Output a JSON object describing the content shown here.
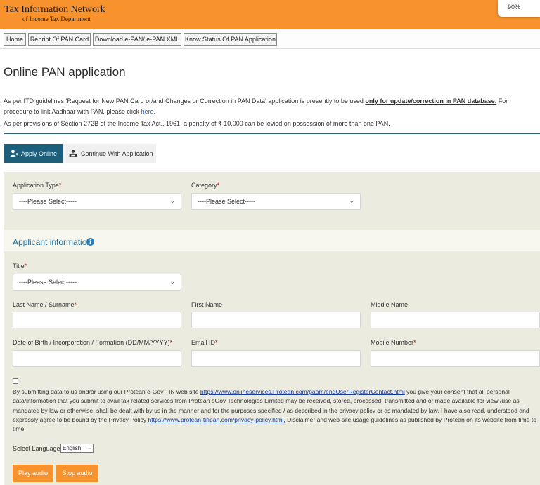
{
  "header": {
    "logo_line1": "Tax Information Network",
    "logo_line2": "of Income Tax Department",
    "zoom": "90%"
  },
  "nav": {
    "items": [
      "Home",
      "Reprint Of PAN Card",
      "Download e-PAN/ e-PAN XML",
      "Know Status Of PAN Application"
    ]
  },
  "page": {
    "title": "Online PAN application",
    "para1_pre": "As per ITD guidelines,'Request for New PAN Card or/and Changes or Correction in PAN Data' application is presently to be used ",
    "para1_bold": "only for update/correction in PAN database.",
    "para1_post": " For procedure to link Aadhaar with PAN, please click ",
    "para1_link": "here",
    "para1_end": ".",
    "para2": "As per provisions of Section 272B of the Income Tax Act., 1961, a penalty of ₹ 10,000 can be levied on possession of more than one PAN."
  },
  "tabs": {
    "apply": "Apply Online",
    "continue": "Continue With Application"
  },
  "form": {
    "application_type_label": "Application Type",
    "application_type_value": "----Please Select-----",
    "category_label": "Category",
    "category_value": "----Please Select-----",
    "applicant_heading": "Applicant information",
    "title_label": "Title",
    "title_value": "----Please Select-----",
    "last_name_label": "Last Name / Surname",
    "first_name_label": "First Name",
    "middle_name_label": "Middle Name",
    "dob_label": "Date of Birth / Incorporation / Formation (DD/MM/YYYY)",
    "email_label": "Email ID",
    "mobile_label": "Mobile Number",
    "required_mark": "*"
  },
  "consent": {
    "t1": "By submitting data to us and/or using our Protean e-Gov TIN web site ",
    "link1": "https://www.onlineservices.Protean.com/paam/endUserRegisterContact.html",
    "t2": " you give your consent that all personal data/information that you submit to avail tax related services from Protean eGov Technologies Limited may be received, stored, processed, transmitted and or made available for view /use as mandated by law or otherwise, shall be dealt with by us in the manner and for the purposes specified / as described in the privacy policy or as mandated by law. I have also read, understood and expressly agree to be bound by the Privacy Policy ",
    "link2": "https://www.protean-tinpan.com/privacy-policy.html",
    "t3": ", Disclaimer and web-site usage guidelines as published by Protean on its website from time to time."
  },
  "language": {
    "label": "Select Language",
    "value": "English"
  },
  "audio": {
    "play": "Play audio",
    "stop": "Stop audio"
  }
}
